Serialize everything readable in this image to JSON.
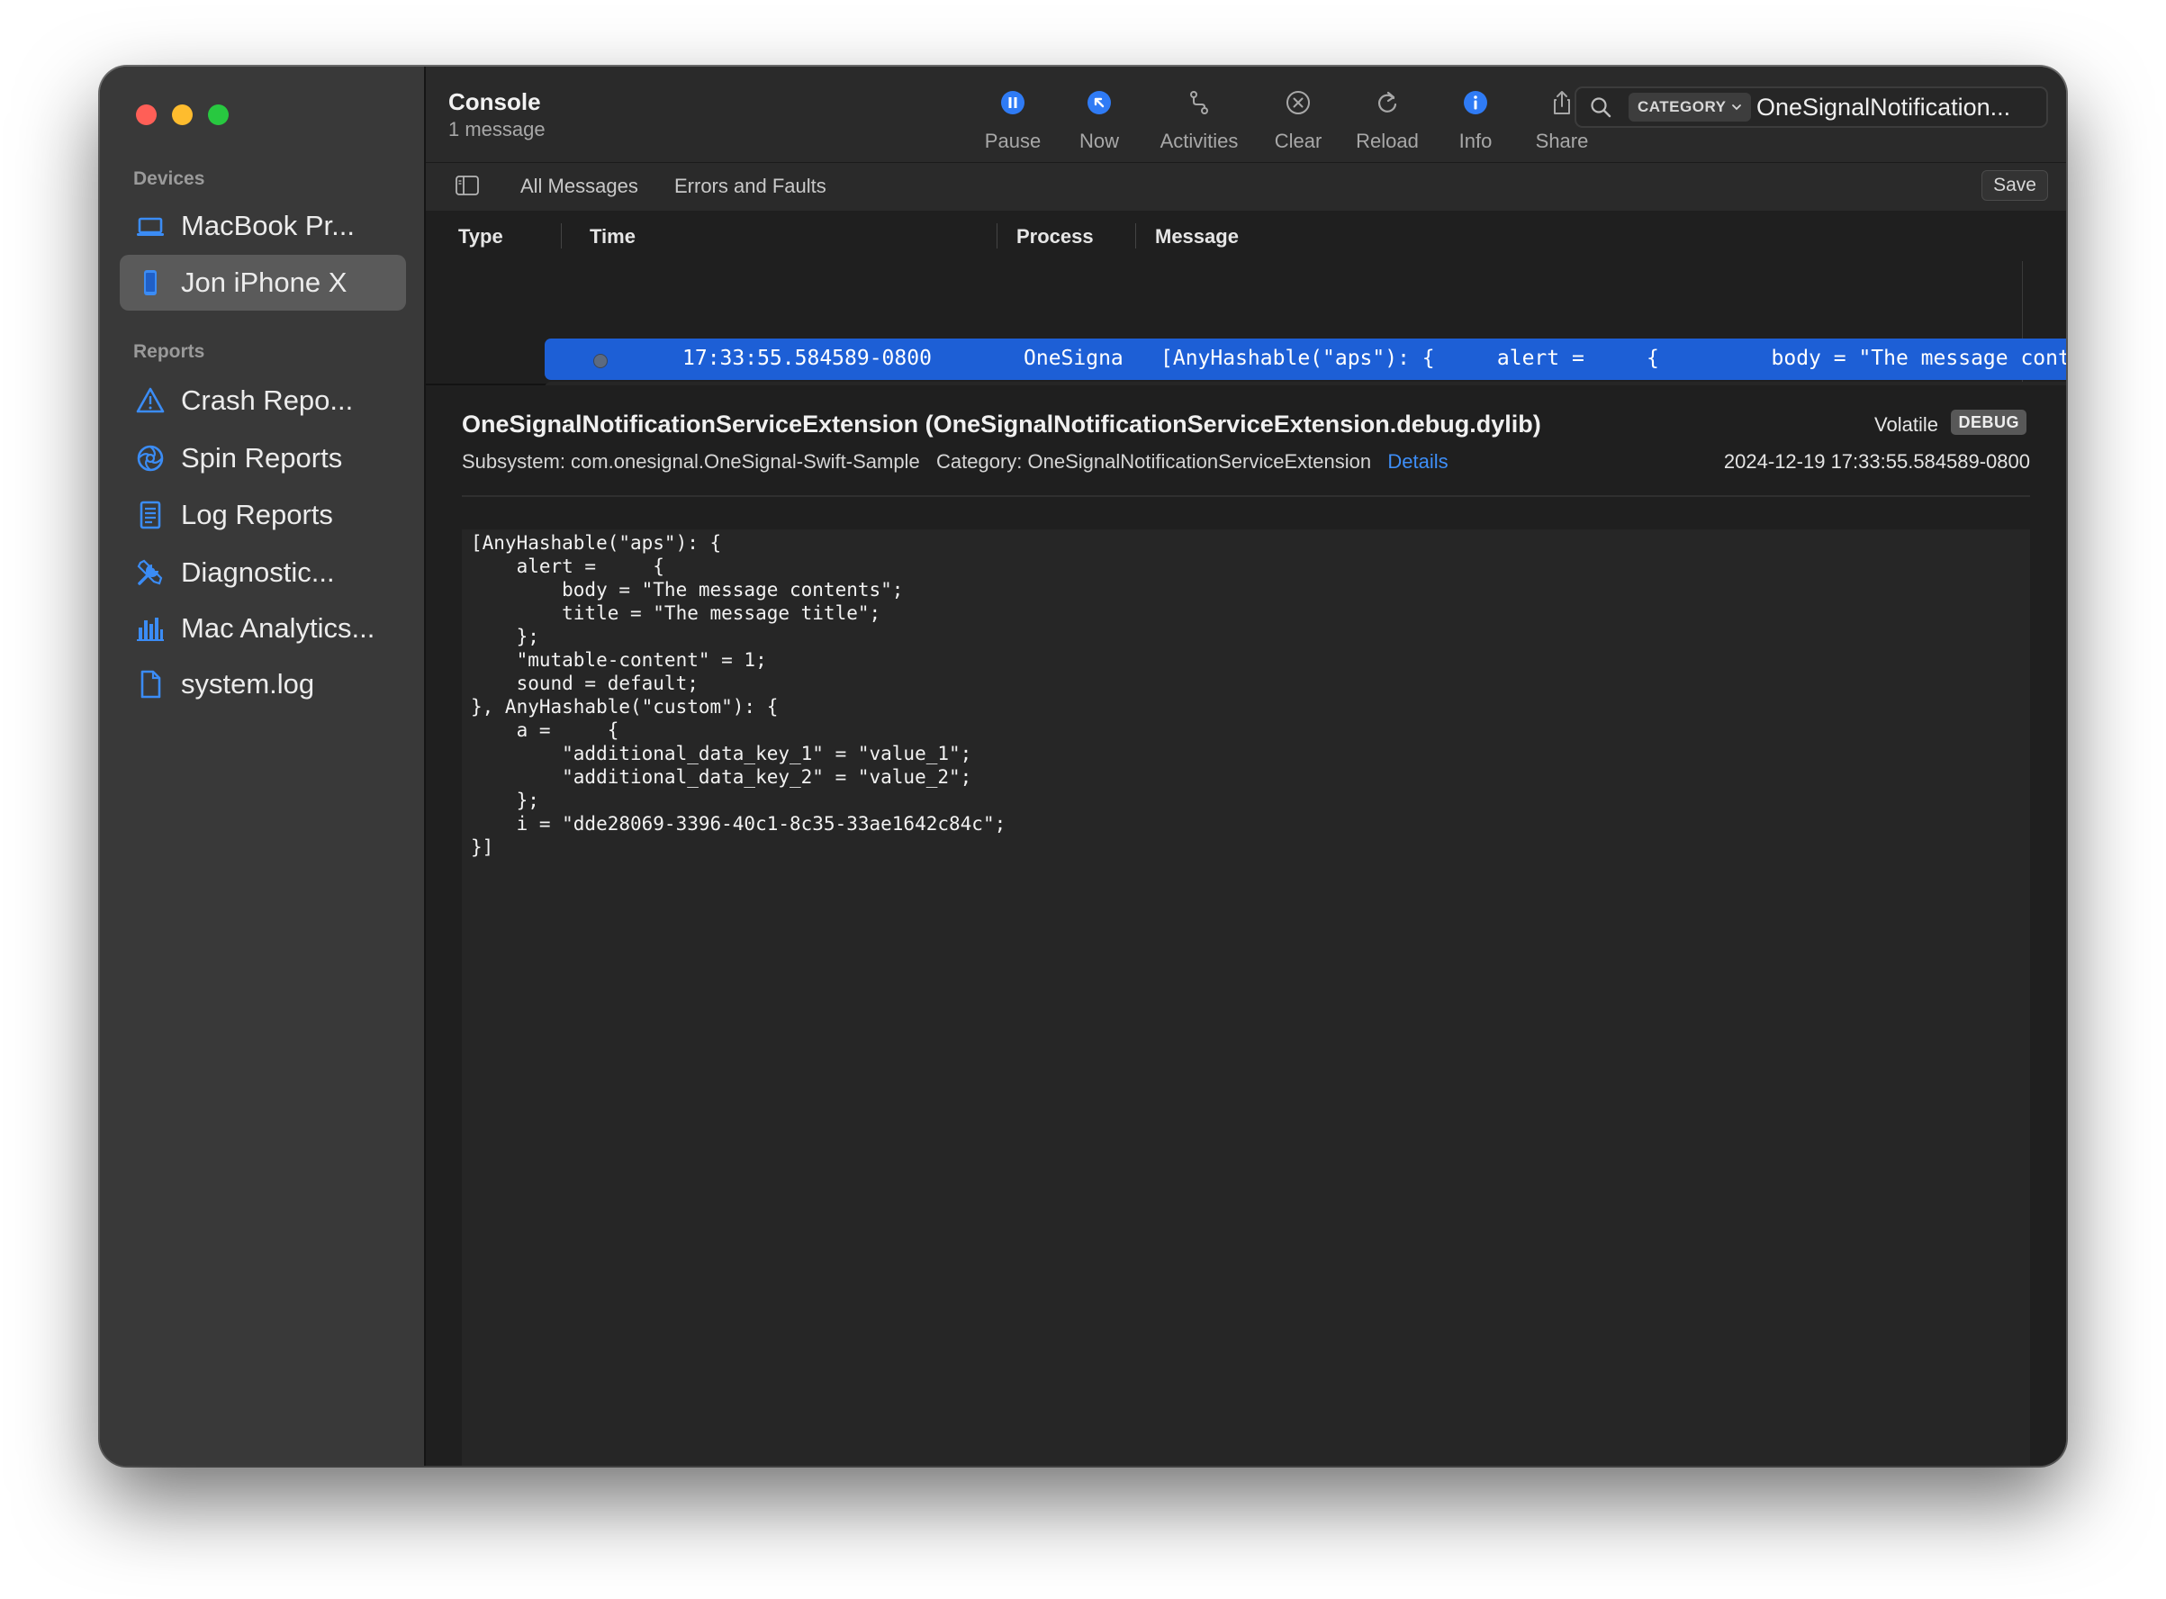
{
  "window": {
    "colors": {
      "close": "#ff5f57",
      "minimize": "#febc2e",
      "zoom": "#28c840"
    }
  },
  "sidebar": {
    "devices_header": "Devices",
    "devices": [
      {
        "label": "MacBook Pr...",
        "icon": "laptop-icon"
      },
      {
        "label": "Jon iPhone X",
        "icon": "iphone-icon",
        "selected": true
      }
    ],
    "reports_header": "Reports",
    "reports": [
      {
        "label": "Crash Repo...",
        "icon": "warning-triangle-icon"
      },
      {
        "label": "Spin Reports",
        "icon": "spin-icon"
      },
      {
        "label": "Log Reports",
        "icon": "log-document-icon"
      },
      {
        "label": "Diagnostic...",
        "icon": "tools-icon"
      },
      {
        "label": "Mac Analytics...",
        "icon": "bar-chart-icon"
      },
      {
        "label": "system.log",
        "icon": "file-icon"
      }
    ]
  },
  "toolbar": {
    "title": "Console",
    "subtitle": "1 message",
    "buttons": [
      {
        "label": "Pause",
        "icon": "pause-icon"
      },
      {
        "label": "Now",
        "icon": "now-icon"
      },
      {
        "label": "Activities",
        "icon": "activities-icon"
      },
      {
        "label": "Clear",
        "icon": "clear-icon"
      },
      {
        "label": "Reload",
        "icon": "reload-icon"
      },
      {
        "label": "Info",
        "icon": "info-icon"
      },
      {
        "label": "Share",
        "icon": "share-icon"
      }
    ],
    "search": {
      "token": "CATEGORY",
      "value": "OneSignalNotification..."
    }
  },
  "filterbar": {
    "all_messages": "All Messages",
    "errors_faults": "Errors and Faults",
    "save": "Save"
  },
  "columns": {
    "type": "Type",
    "time": "Time",
    "process": "Process",
    "message": "Message"
  },
  "log_row": {
    "time": "17:33:55.584589-0800",
    "process": "OneSignal",
    "message": "[AnyHashable(\"aps\"): {     alert =     {         body = \"The message contents\";"
  },
  "detail": {
    "title": "OneSignalNotificationServiceExtension (OneSignalNotificationServiceExtension.debug.dylib)",
    "subsystem": "Subsystem: com.onesignal.OneSignal-Swift-Sample",
    "category": "Category: OneSignalNotificationServiceExtension",
    "details_link": "Details",
    "volatile": "Volatile",
    "badge": "DEBUG",
    "timestamp": "2024-12-19 17:33:55.584589-0800",
    "body": "[AnyHashable(\"aps\"): {\n    alert =     {\n        body = \"The message contents\";\n        title = \"The message title\";\n    };\n    \"mutable-content\" = 1;\n    sound = default;\n}, AnyHashable(\"custom\"): {\n    a =     {\n        \"additional_data_key_1\" = \"value_1\";\n        \"additional_data_key_2\" = \"value_2\";\n    };\n    i = \"dde28069-3396-40c1-8c35-33ae1642c84c\";\n}]"
  },
  "colors": {
    "accent": "#1d5fd6",
    "link": "#3e8ef7",
    "icon_blue": "#2f7bf5"
  }
}
